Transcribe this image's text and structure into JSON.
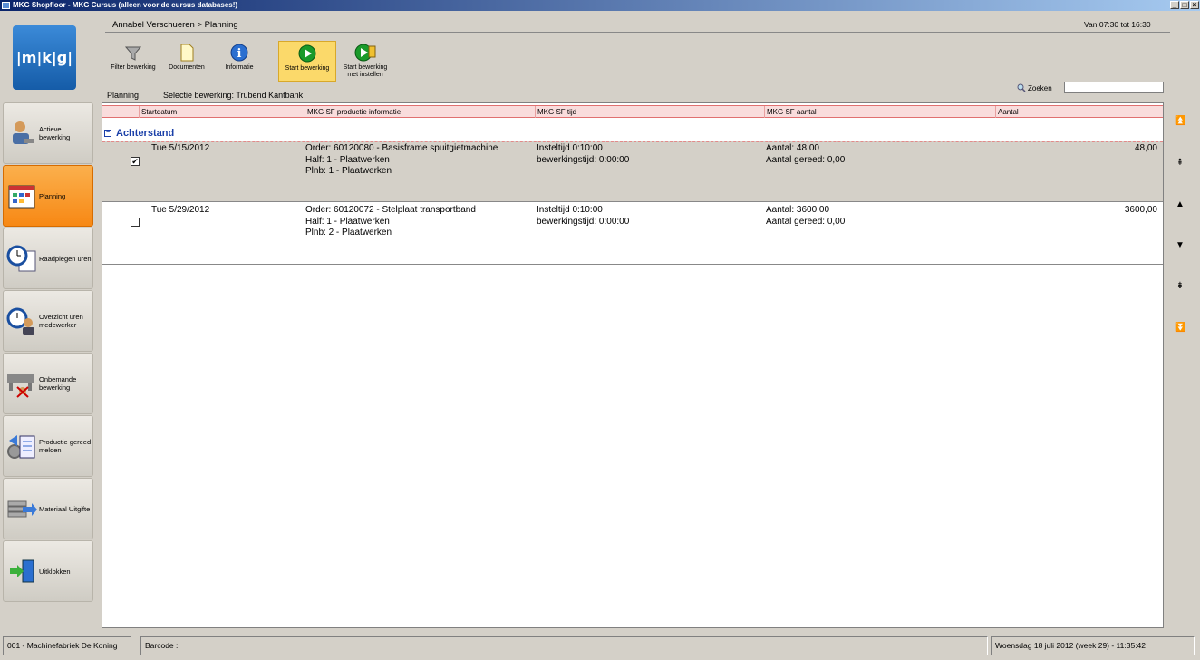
{
  "window": {
    "title": "MKG Shopfloor - MKG Cursus (alleen voor de cursus databases!)"
  },
  "logo": {
    "text": "|m|k|g|"
  },
  "breadcrumb": "Annabel Verschueren > Planning",
  "time_window": "Van 07:30 tot 16:30",
  "toolbar": [
    {
      "label": "Filter bewerking",
      "icon": "filter-icon"
    },
    {
      "label": "Documenten",
      "icon": "document-icon"
    },
    {
      "label": "Informatie",
      "icon": "info-icon"
    },
    {
      "label": "Start bewerking",
      "icon": "play-icon"
    },
    {
      "label1": "Start bewerking",
      "label2": "met instellen",
      "icon": "play-settings-icon"
    }
  ],
  "nav": [
    {
      "label": "Actieve bewerking",
      "icon": "worker-icon"
    },
    {
      "label": "Planning",
      "icon": "calendar-icon"
    },
    {
      "label": "Raadplegen uren",
      "icon": "clock-sheet-icon"
    },
    {
      "label": "Overzicht uren medewerker",
      "icon": "clock-person-icon"
    },
    {
      "label": "Onbemande bewerking",
      "icon": "machine-icon"
    },
    {
      "label": "Productie gereed melden",
      "icon": "gear-report-icon"
    },
    {
      "label": "Materiaal Uitgifte",
      "icon": "material-icon"
    },
    {
      "label": "Uitklokken",
      "icon": "exit-door-icon"
    }
  ],
  "subheader": {
    "left": "Planning",
    "selection": "Selectie bewerking: Trubend Kantbank"
  },
  "search": {
    "label": "Zoeken",
    "value": ""
  },
  "table": {
    "columns": [
      "Startdatum",
      "MKG SF productie informatie",
      "MKG SF tijd",
      "MKG SF aantal",
      "Aantal"
    ],
    "group": "Achterstand",
    "rows": [
      {
        "checked": true,
        "date": "Tue 5/15/2012",
        "info": [
          "Order: 60120080 - Basisframe spuitgietmachine",
          "Half: 1 - Plaatwerken",
          "Plnb: 1 - Plaatwerken"
        ],
        "tijd": [
          "Insteltijd 0:10:00",
          "bewerkingstijd: 0:00:00"
        ],
        "aantal_info": [
          "Aantal: 48,00",
          "Aantal gereed: 0,00"
        ],
        "aantal": "48,00"
      },
      {
        "checked": false,
        "date": "Tue 5/29/2012",
        "info": [
          "Order: 60120072 - Stelplaat transportband",
          "Half: 1 - Plaatwerken",
          "Plnb: 2 - Plaatwerken"
        ],
        "tijd": [
          "Insteltijd 0:10:00",
          "bewerkingstijd: 0:00:00"
        ],
        "aantal_info": [
          "Aantal: 3600,00",
          "Aantal gereed: 0,00"
        ],
        "aantal": "3600,00"
      }
    ]
  },
  "scroll": {
    "top": "⏫",
    "pageup": "⇞",
    "up": "▲",
    "down": "▼",
    "pagedown": "⇟",
    "bottom": "⏬"
  },
  "statusbar": {
    "company": "001 - Machinefabriek De Koning",
    "barcode": "Barcode :",
    "datetime": "Woensdag 18 juli 2012 (week 29) - 11:35:42"
  }
}
